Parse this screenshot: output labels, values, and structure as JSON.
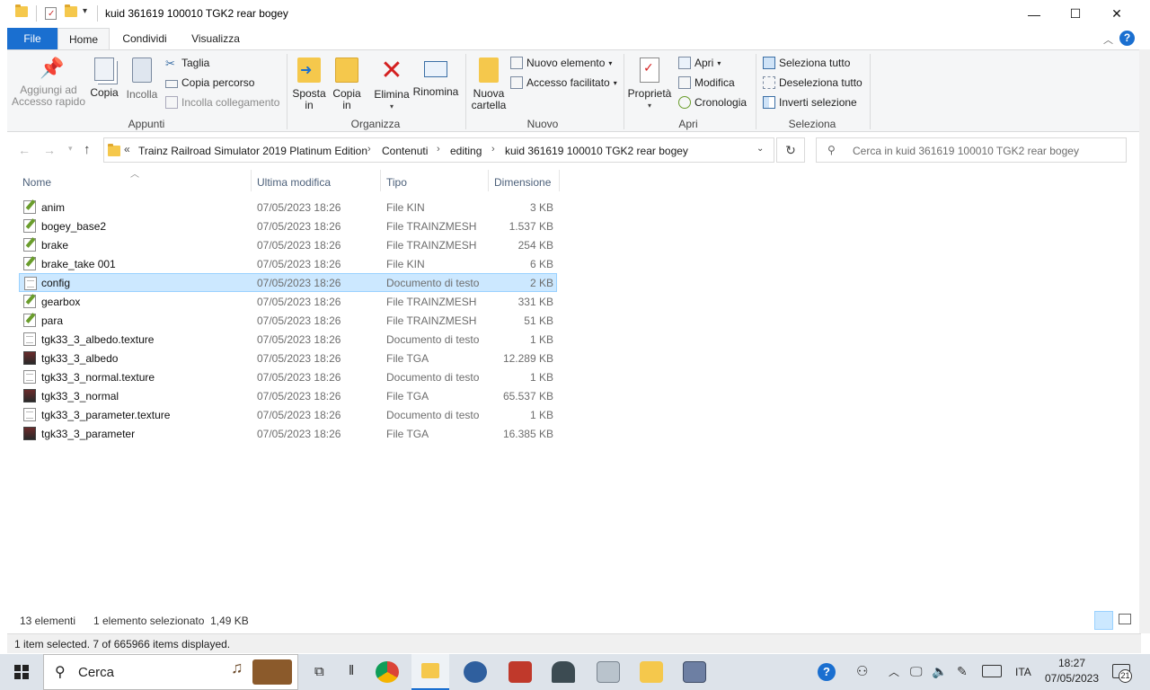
{
  "window": {
    "title": "kuid 361619 100010 TGK2 rear bogey",
    "minimize_glyph": "—",
    "maximize_glyph": "☐",
    "close_glyph": "✕"
  },
  "ribbon_tabs": [
    "File",
    "Home",
    "Condividi",
    "Visualizza"
  ],
  "ribbon": {
    "appunti": {
      "label": "Appunti",
      "pin": "Aggiungi ad\nAccesso rapido",
      "copy": "Copia",
      "paste": "Incolla",
      "cut": "Taglia",
      "copy_path": "Copia percorso",
      "paste_link": "Incolla collegamento"
    },
    "organizza": {
      "label": "Organizza",
      "move_to": "Sposta\nin",
      "copy_to": "Copia\nin",
      "delete": "Elimina",
      "rename": "Rinomina"
    },
    "nuovo": {
      "label": "Nuovo",
      "new_folder": "Nuova\ncartella",
      "new_item": "Nuovo elemento",
      "easy_access": "Accesso facilitato"
    },
    "apri": {
      "label": "Apri",
      "properties": "Proprietà",
      "open": "Apri",
      "edit": "Modifica",
      "history": "Cronologia"
    },
    "seleziona": {
      "label": "Seleziona",
      "select_all": "Seleziona tutto",
      "select_none": "Deseleziona tutto",
      "invert": "Inverti selezione"
    }
  },
  "address": {
    "prefix": "«",
    "crumbs": [
      "Trainz Railroad Simulator 2019 Platinum Edition",
      "Contenuti",
      "editing",
      "kuid 361619 100010 TGK2 rear bogey"
    ],
    "search_placeholder": "Cerca in kuid 361619 100010 TGK2 rear bogey"
  },
  "columns": [
    "Nome",
    "Ultima modifica",
    "Tipo",
    "Dimensione"
  ],
  "files": [
    {
      "name": "anim",
      "date": "07/05/2023 18:26",
      "type": "File KIN",
      "size": "3 KB",
      "icon": "edit-file-icon"
    },
    {
      "name": "bogey_base2",
      "date": "07/05/2023 18:26",
      "type": "File TRAINZMESH",
      "size": "1.537 KB",
      "icon": "edit-file-icon"
    },
    {
      "name": "brake",
      "date": "07/05/2023 18:26",
      "type": "File TRAINZMESH",
      "size": "254 KB",
      "icon": "edit-file-icon"
    },
    {
      "name": "brake_take 001",
      "date": "07/05/2023 18:26",
      "type": "File KIN",
      "size": "6 KB",
      "icon": "edit-file-icon"
    },
    {
      "name": "config",
      "date": "07/05/2023 18:26",
      "type": "Documento di testo",
      "size": "2 KB",
      "icon": "text-file-icon",
      "selected": true
    },
    {
      "name": "gearbox",
      "date": "07/05/2023 18:26",
      "type": "File TRAINZMESH",
      "size": "331 KB",
      "icon": "edit-file-icon"
    },
    {
      "name": "para",
      "date": "07/05/2023 18:26",
      "type": "File TRAINZMESH",
      "size": "51 KB",
      "icon": "edit-file-icon"
    },
    {
      "name": "tgk33_3_albedo.texture",
      "date": "07/05/2023 18:26",
      "type": "Documento di testo",
      "size": "1 KB",
      "icon": "text-file-icon"
    },
    {
      "name": "tgk33_3_albedo",
      "date": "07/05/2023 18:26",
      "type": "File TGA",
      "size": "12.289 KB",
      "icon": "tga-file-icon"
    },
    {
      "name": "tgk33_3_normal.texture",
      "date": "07/05/2023 18:26",
      "type": "Documento di testo",
      "size": "1 KB",
      "icon": "text-file-icon"
    },
    {
      "name": "tgk33_3_normal",
      "date": "07/05/2023 18:26",
      "type": "File TGA",
      "size": "65.537 KB",
      "icon": "tga-file-icon"
    },
    {
      "name": "tgk33_3_parameter.texture",
      "date": "07/05/2023 18:26",
      "type": "Documento di testo",
      "size": "1 KB",
      "icon": "text-file-icon"
    },
    {
      "name": "tgk33_3_parameter",
      "date": "07/05/2023 18:26",
      "type": "File TGA",
      "size": "16.385 KB",
      "icon": "tga-file-icon"
    }
  ],
  "status": {
    "count": "13 elementi",
    "selection": "1 elemento selezionato  1,49 KB",
    "overlay": "1 item selected. 7 of 665966 items displayed."
  },
  "taskbar": {
    "search_label": "Cerca",
    "language": "ITA",
    "time": "18:27",
    "date": "07/05/2023",
    "notifications": "21"
  },
  "colors": {
    "accent": "#1a6fd0",
    "selection": "#cce8ff",
    "selection_border": "#99d1ff",
    "folder": "#f5c84c"
  }
}
